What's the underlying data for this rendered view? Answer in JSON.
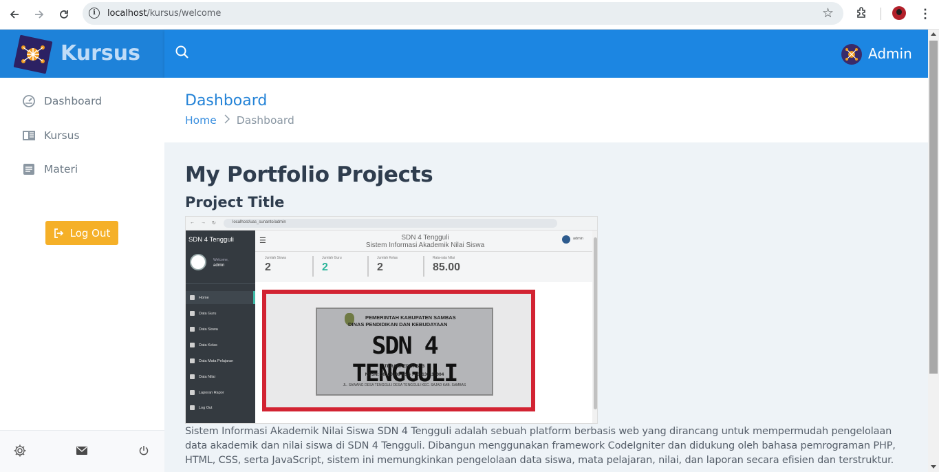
{
  "browser": {
    "url_host": "localhost",
    "url_path": "/kursus/welcome"
  },
  "app": {
    "brand": "Kursus",
    "user_name": "Admin"
  },
  "sidebar": {
    "items": [
      {
        "label": "Dashboard",
        "icon": "dashboard-icon"
      },
      {
        "label": "Kursus",
        "icon": "book-icon"
      },
      {
        "label": "Materi",
        "icon": "document-icon"
      }
    ],
    "logout_label": "Log Out",
    "footer_icons": [
      "settings-icon",
      "mail-icon",
      "power-icon"
    ]
  },
  "page": {
    "title": "Dashboard",
    "breadcrumb": {
      "home": "Home",
      "current": "Dashboard"
    }
  },
  "content": {
    "heading": "My Portfolio Projects",
    "project_title": "Project Title",
    "description": "Sistem Informasi Akademik Nilai Siswa SDN 4 Tengguli adalah sebuah platform berbasis web yang dirancang untuk mempermudah pengelolaan data akademik dan nilai siswa di SDN 4 Tengguli. Dibangun menggunakan framework CodeIgniter dan didukung oleh bahasa pemrograman PHP, HTML, CSS, serta JavaScript, sistem ini memungkinkan pengelolaan data siswa, mata pelajaran, nilai, dan laporan secara efisien dan terstruktur."
  },
  "project_screenshot": {
    "url": "localhost/uas_sunanto/admin",
    "app_name": "SDN 4 Tengguli",
    "header_line1": "SDN 4 Tengguli",
    "header_line2": "Sistem Informasi Akademik Nilai Siswa",
    "welcome": "Welcome,",
    "user": "admin",
    "menu": [
      "Home",
      "Data Guru",
      "Data Siswa",
      "Data Kelas",
      "Data Mata Pelajaran",
      "Data Nilai",
      "Laporan Rapor",
      "Log Out"
    ],
    "stats": [
      {
        "label": "Jumlah Siswa",
        "value": "2"
      },
      {
        "label": "Jumlah Guru",
        "value": "2"
      },
      {
        "label": "Jumlah Kelas",
        "value": "2"
      },
      {
        "label": "Rata-rata Nilai",
        "value": "85.00"
      }
    ],
    "plate": {
      "line1": "PEMERINTAH KABUPATEN SAMBAS",
      "line2": "DINAS PENDIDIKAN DAN KEBUDAYAAN",
      "school": "SDN 4 TENGGULI",
      "accreditation": "TERAKREDITASI  B",
      "ids": "NPSN: 30100438     NSS : 101130115004",
      "address": "JL. SAWANG DESA TENGGULI DESA TENGGULI KEC. SAJAD KAB. SAMBAS"
    }
  },
  "colors": {
    "header_blue": "#1c86e2",
    "logo_area_blue": "#1e82d9",
    "logout_orange": "#f5b028",
    "title_blue": "#2483d7",
    "content_bg": "#eef3f7"
  }
}
